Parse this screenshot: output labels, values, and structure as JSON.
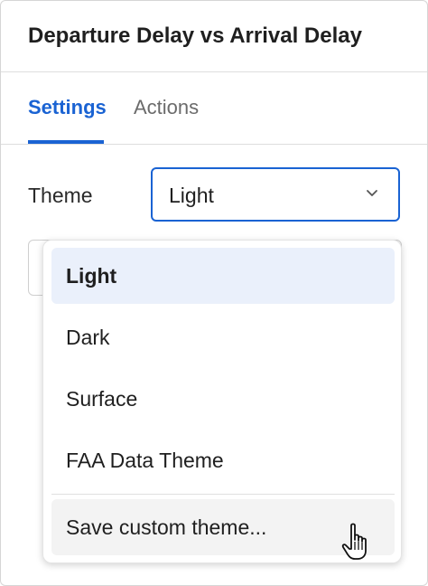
{
  "header": {
    "title": "Departure Delay vs Arrival Delay"
  },
  "tabs": [
    {
      "label": "Settings",
      "active": true
    },
    {
      "label": "Actions",
      "active": false
    }
  ],
  "theme": {
    "label": "Theme",
    "selected": "Light",
    "icon": "chevron-down-icon"
  },
  "dropdown": {
    "options": [
      {
        "label": "Light",
        "selected": true
      },
      {
        "label": "Dark",
        "selected": false
      },
      {
        "label": "Surface",
        "selected": false
      },
      {
        "label": "FAA Data Theme",
        "selected": false
      }
    ],
    "action_label": "Save custom theme..."
  },
  "colors": {
    "accent": "#1a63d3",
    "selected_bg": "#eaf0fb",
    "border": "#dedede"
  },
  "cursor": {
    "icon": "hand-pointer-icon"
  }
}
